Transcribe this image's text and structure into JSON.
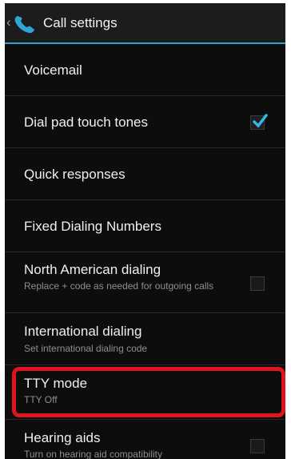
{
  "header": {
    "title": "Call settings",
    "up_icon": "chevron-left-icon",
    "app_icon": "phone-icon",
    "accent_color": "#2ea3cc"
  },
  "items": [
    {
      "id": "voicemail",
      "label": "Voicemail",
      "summary": "",
      "checkbox": null
    },
    {
      "id": "dial-pad-touch-tones",
      "label": "Dial pad touch tones",
      "summary": "",
      "checkbox": true
    },
    {
      "id": "quick-responses",
      "label": "Quick responses",
      "summary": "",
      "checkbox": null
    },
    {
      "id": "fixed-dialing-numbers",
      "label": "Fixed Dialing Numbers",
      "summary": "",
      "checkbox": null
    },
    {
      "id": "north-american-dialing",
      "label": "North American dialing",
      "summary": "Replace + code as needed for outgoing calls",
      "checkbox": false
    },
    {
      "id": "international-dialing",
      "label": "International dialing",
      "summary": "Set international dialing code",
      "checkbox": null
    },
    {
      "id": "tty-mode",
      "label": "TTY mode",
      "summary": "TTY Off",
      "checkbox": null,
      "highlighted": true
    },
    {
      "id": "hearing-aids",
      "label": "Hearing aids",
      "summary": "Turn on hearing aid compatibility",
      "checkbox": false
    }
  ],
  "highlight_color": "#e0141c"
}
